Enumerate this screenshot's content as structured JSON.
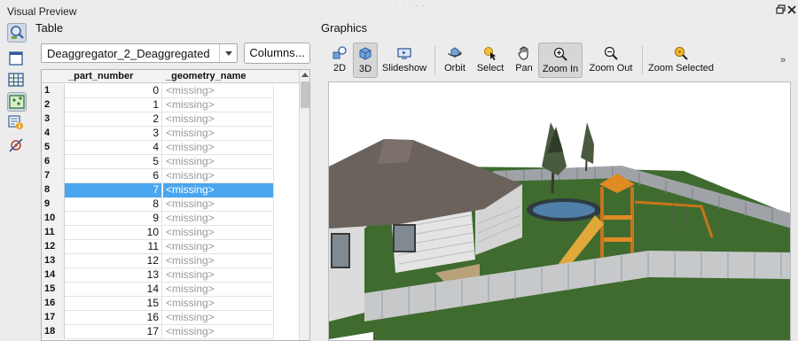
{
  "window": {
    "title": "Visual Preview",
    "restore_icon": "restore-icon",
    "close_icon": "close-icon"
  },
  "left_toolbar": {
    "buttons": [
      {
        "name": "inspect-icon",
        "active": true
      },
      {
        "name": "panel-layout-icon",
        "active": false
      },
      {
        "name": "table-view-icon",
        "active": false
      },
      {
        "name": "graphics-view-icon",
        "active": true
      },
      {
        "name": "feature-info-icon",
        "active": false
      },
      {
        "name": "coordinate-tool-icon",
        "active": false
      }
    ]
  },
  "table_panel": {
    "label": "Table",
    "dataset_select": "Deaggregator_2_Deaggregated",
    "columns_button": "Columns...",
    "headers": [
      "",
      "_part_number",
      "_geometry_name"
    ],
    "selected_row": 8,
    "rows": [
      {
        "row": "1",
        "part_number": "0",
        "geometry_name": "<missing>"
      },
      {
        "row": "2",
        "part_number": "1",
        "geometry_name": "<missing>"
      },
      {
        "row": "3",
        "part_number": "2",
        "geometry_name": "<missing>"
      },
      {
        "row": "4",
        "part_number": "3",
        "geometry_name": "<missing>"
      },
      {
        "row": "5",
        "part_number": "4",
        "geometry_name": "<missing>"
      },
      {
        "row": "6",
        "part_number": "5",
        "geometry_name": "<missing>"
      },
      {
        "row": "7",
        "part_number": "6",
        "geometry_name": "<missing>"
      },
      {
        "row": "8",
        "part_number": "7",
        "geometry_name": "<missing>"
      },
      {
        "row": "9",
        "part_number": "8",
        "geometry_name": "<missing>"
      },
      {
        "row": "10",
        "part_number": "9",
        "geometry_name": "<missing>"
      },
      {
        "row": "11",
        "part_number": "10",
        "geometry_name": "<missing>"
      },
      {
        "row": "12",
        "part_number": "11",
        "geometry_name": "<missing>"
      },
      {
        "row": "13",
        "part_number": "12",
        "geometry_name": "<missing>"
      },
      {
        "row": "14",
        "part_number": "13",
        "geometry_name": "<missing>"
      },
      {
        "row": "15",
        "part_number": "14",
        "geometry_name": "<missing>"
      },
      {
        "row": "16",
        "part_number": "15",
        "geometry_name": "<missing>"
      },
      {
        "row": "17",
        "part_number": "16",
        "geometry_name": "<missing>"
      },
      {
        "row": "18",
        "part_number": "17",
        "geometry_name": "<missing>"
      }
    ]
  },
  "graphics_panel": {
    "label": "Graphics",
    "toolbar": [
      {
        "id": "2d",
        "label": "2D",
        "icon": "2d-shapes-icon",
        "pressed": false
      },
      {
        "id": "3d",
        "label": "3D",
        "icon": "3d-cube-icon",
        "pressed": true
      },
      {
        "id": "slideshow",
        "label": "Slideshow",
        "icon": "slideshow-icon",
        "pressed": false
      },
      {
        "id": "orbit",
        "label": "Orbit",
        "icon": "orbit-icon",
        "pressed": false
      },
      {
        "id": "select",
        "label": "Select",
        "icon": "select-cursor-icon",
        "pressed": false
      },
      {
        "id": "pan",
        "label": "Pan",
        "icon": "pan-hand-icon",
        "pressed": false
      },
      {
        "id": "zoom_in",
        "label": "Zoom In",
        "icon": "zoom-in-icon",
        "pressed": true
      },
      {
        "id": "zoom_out",
        "label": "Zoom Out",
        "icon": "zoom-out-icon",
        "pressed": false
      },
      {
        "id": "zoom_selected",
        "label": "Zoom Selected",
        "icon": "zoom-selected-icon",
        "pressed": false
      }
    ],
    "overflow": "»",
    "scene": "3d-backyard-scene"
  },
  "colors": {
    "selection": "#4aa6ee",
    "missing_text": "#9a9a9a",
    "grass": "#3f6b2f",
    "house_wall": "#e4e4e4",
    "roof": "#6c625c",
    "playset": "#e08a24",
    "pool": "#4f7fa8"
  }
}
